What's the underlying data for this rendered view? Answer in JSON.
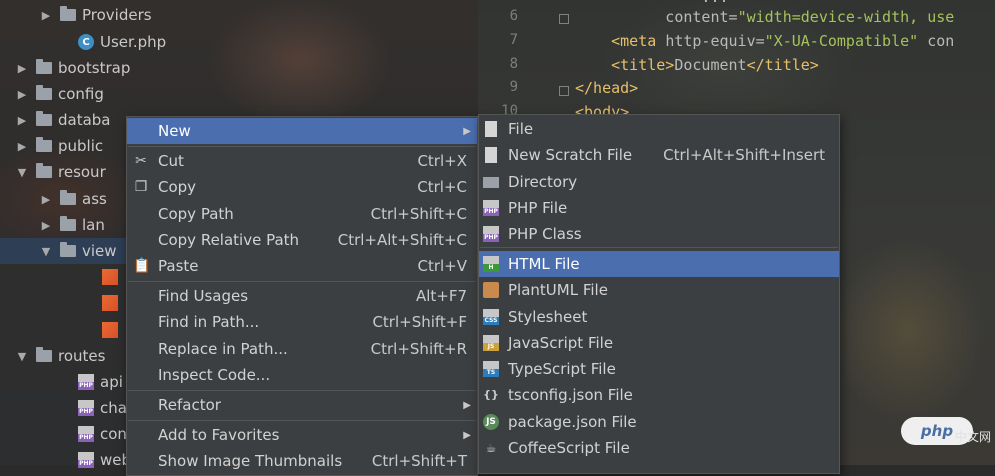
{
  "tree": {
    "items": [
      {
        "label": "Providers",
        "kind": "folder",
        "arrow": "▶"
      },
      {
        "label": "User.php",
        "kind": "class",
        "arrow": ""
      },
      {
        "label": "bootstrap",
        "kind": "folder",
        "arrow": "▶"
      },
      {
        "label": "config",
        "kind": "folder",
        "arrow": "▶"
      },
      {
        "label": "databa",
        "kind": "folder",
        "arrow": "▶"
      },
      {
        "label": "public",
        "kind": "folder",
        "arrow": "▶"
      },
      {
        "label": "resour",
        "kind": "folder",
        "arrow": "▼"
      },
      {
        "label": "ass",
        "kind": "folder",
        "arrow": "▶"
      },
      {
        "label": "lan",
        "kind": "folder",
        "arrow": "▶"
      },
      {
        "label": "view",
        "kind": "folder",
        "arrow": "▼"
      },
      {
        "label": "",
        "kind": "blade",
        "arrow": ""
      },
      {
        "label": "",
        "kind": "blade",
        "arrow": ""
      },
      {
        "label": "",
        "kind": "blade",
        "arrow": ""
      },
      {
        "label": "routes",
        "kind": "folder",
        "arrow": "▼"
      },
      {
        "label": "api",
        "kind": "php",
        "arrow": ""
      },
      {
        "label": "cha",
        "kind": "php",
        "arrow": ""
      },
      {
        "label": "con",
        "kind": "php",
        "arrow": ""
      },
      {
        "label": "web",
        "kind": "php",
        "arrow": ""
      }
    ],
    "php_icon_text": "PHP",
    "class_icon_text": "C"
  },
  "editor": {
    "lines": [
      {
        "num": "",
        "html_parts": [
          {
            "t": "attr",
            "v": "              ..."
          }
        ]
      },
      {
        "num": "6",
        "html_parts": [
          {
            "t": "attr",
            "v": "          content="
          },
          {
            "t": "str",
            "v": "\"width=device-width, use"
          }
        ]
      },
      {
        "num": "7",
        "html_parts": [
          {
            "t": "tag",
            "v": "    <meta "
          },
          {
            "t": "attr",
            "v": "http-equiv="
          },
          {
            "t": "str",
            "v": "\"X-UA-Compatible\" "
          },
          {
            "t": "attr",
            "v": "con"
          }
        ]
      },
      {
        "num": "8",
        "html_parts": [
          {
            "t": "tag",
            "v": "    <title>"
          },
          {
            "t": "attr",
            "v": "Document"
          },
          {
            "t": "tag",
            "v": "</title>"
          }
        ]
      },
      {
        "num": "9",
        "html_parts": [
          {
            "t": "tag",
            "v": "</head>"
          }
        ]
      },
      {
        "num": "10",
        "html_parts": [
          {
            "t": "tag",
            "v": "<body>"
          }
        ]
      }
    ]
  },
  "context_menu": {
    "items": [
      {
        "label": "New",
        "shortcut": "",
        "icon": "",
        "submenu": true,
        "highlight": true
      },
      {
        "label": "Cut",
        "shortcut": "Ctrl+X",
        "icon": "✂",
        "submenu": false
      },
      {
        "label": "Copy",
        "shortcut": "Ctrl+C",
        "icon": "❐",
        "submenu": false
      },
      {
        "label": "Copy Path",
        "shortcut": "Ctrl+Shift+C",
        "icon": "",
        "submenu": false
      },
      {
        "label": "Copy Relative Path",
        "shortcut": "Ctrl+Alt+Shift+C",
        "icon": "",
        "submenu": false
      },
      {
        "label": "Paste",
        "shortcut": "Ctrl+V",
        "icon": "📋",
        "submenu": false
      },
      {
        "label": "Find Usages",
        "shortcut": "Alt+F7",
        "icon": "",
        "submenu": false
      },
      {
        "label": "Find in Path...",
        "shortcut": "Ctrl+Shift+F",
        "icon": "",
        "submenu": false
      },
      {
        "label": "Replace in Path...",
        "shortcut": "Ctrl+Shift+R",
        "icon": "",
        "submenu": false
      },
      {
        "label": "Inspect Code...",
        "shortcut": "",
        "icon": "",
        "submenu": false
      },
      {
        "label": "Refactor",
        "shortcut": "",
        "icon": "",
        "submenu": true
      },
      {
        "label": "Add to Favorites",
        "shortcut": "",
        "icon": "",
        "submenu": true
      },
      {
        "label": "Show Image Thumbnails",
        "shortcut": "Ctrl+Shift+T",
        "icon": "",
        "submenu": false
      }
    ],
    "arrow_glyph": "▶"
  },
  "new_submenu": {
    "items": [
      {
        "label": "File",
        "shortcut": "",
        "icon": "file",
        "icon_text": ""
      },
      {
        "label": "New Scratch File",
        "shortcut": "Ctrl+Alt+Shift+Insert",
        "icon": "scratch",
        "icon_text": ""
      },
      {
        "label": "Directory",
        "shortcut": "",
        "icon": "dir",
        "icon_text": ""
      },
      {
        "label": "PHP File",
        "shortcut": "",
        "icon": "php",
        "icon_text": "PHP"
      },
      {
        "label": "PHP Class",
        "shortcut": "",
        "icon": "php",
        "icon_text": "PHP"
      },
      {
        "label": "HTML File",
        "shortcut": "",
        "icon": "html",
        "icon_text": "H",
        "highlight": true
      },
      {
        "label": "PlantUML File",
        "shortcut": "",
        "icon": "puml",
        "icon_text": ""
      },
      {
        "label": "Stylesheet",
        "shortcut": "",
        "icon": "css",
        "icon_text": "CSS"
      },
      {
        "label": "JavaScript File",
        "shortcut": "",
        "icon": "js",
        "icon_text": "JS"
      },
      {
        "label": "TypeScript File",
        "shortcut": "",
        "icon": "ts",
        "icon_text": "TS"
      },
      {
        "label": "tsconfig.json File",
        "shortcut": "",
        "icon": "json",
        "icon_text": "{}"
      },
      {
        "label": "package.json File",
        "shortcut": "",
        "icon": "pkg",
        "icon_text": "JS"
      },
      {
        "label": "CoffeeScript File",
        "shortcut": "",
        "icon": "coffee",
        "icon_text": "☕"
      }
    ]
  },
  "watermark": {
    "text": "php",
    "suffix": "中文网"
  }
}
